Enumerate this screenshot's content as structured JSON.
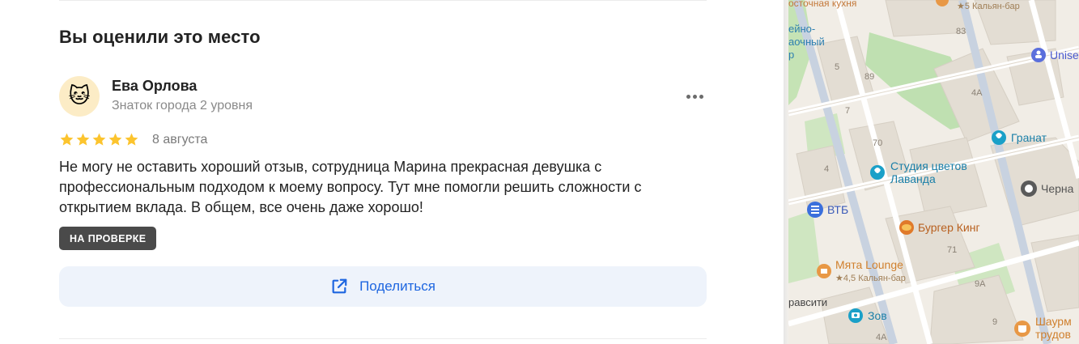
{
  "review_section": {
    "title": "Вы оценили это место",
    "author": {
      "name": "Ева Орлова",
      "level": "Знаток города 2 уровня",
      "avatar": "cat-face-icon"
    },
    "rating": 5,
    "date": "8 августа",
    "text": "Не могу не оставить хороший отзыв, сотрудница Марина прекрасная девушка с профессиональным подходом к моему вопросу. Тут мне помогли решить сложности с открытием вклада. В общем, все очень даже хорошо!",
    "status_badge": "НА ПРОВЕРКЕ",
    "share_label": "Поделиться"
  },
  "colors": {
    "star": "#fcc42e",
    "share_text": "#1e66e0",
    "share_bg": "#eef3fb",
    "badge_bg": "#4a4a4a",
    "map_bg": "#f1ede6",
    "road": "#c8d2e0",
    "park": "#bfe0b1",
    "building": "#e3ddd3"
  },
  "map": {
    "pois": [
      {
        "name": "Гранат",
        "icon": "flower-icon",
        "color": "#1aa0c8"
      },
      {
        "name": "Студия цветов",
        "name2": "Лаванда",
        "icon": "flower-icon",
        "color": "#1aa0c8"
      },
      {
        "name": "ВТБ",
        "icon": "bank-icon",
        "color": "#3a6fdc"
      },
      {
        "name": "Бургер Кинг",
        "icon": "burger-king-icon",
        "color": "#e07a2a"
      },
      {
        "name": "Мята Lounge",
        "icon": "hookah-icon",
        "color": "#e89846"
      },
      {
        "name": "★4,5 Кальян-бар",
        "icon": "rating-star-icon",
        "color": "#b08a5a"
      },
      {
        "name": "Зов",
        "icon": "camera-icon",
        "color": "#1aa0c8"
      },
      {
        "name": "Шаурм",
        "name2": "трудов",
        "icon": "cafe-icon",
        "color": "#e89846"
      },
      {
        "name": "Unise",
        "icon": "person-icon",
        "color": "#5b6fdc"
      },
      {
        "name": "Черна",
        "icon": "lion-icon",
        "color": "#666666"
      },
      {
        "name": "ейно-",
        "name2": "аочный",
        "name3": "р",
        "icon": "",
        "color": "#1aa0c8"
      },
      {
        "name": "осточная кухня",
        "icon": "",
        "color": "#e89846"
      },
      {
        "name": "★5 Кальян-бар",
        "icon": "rating-star-icon",
        "color": "#b08a5a"
      },
      {
        "name": "равсити",
        "icon": "",
        "color": "#444444"
      }
    ],
    "house_numbers": [
      "83",
      "5",
      "89",
      "4A",
      "7",
      "70",
      "4",
      "71",
      "9A",
      "9",
      "4A"
    ]
  }
}
